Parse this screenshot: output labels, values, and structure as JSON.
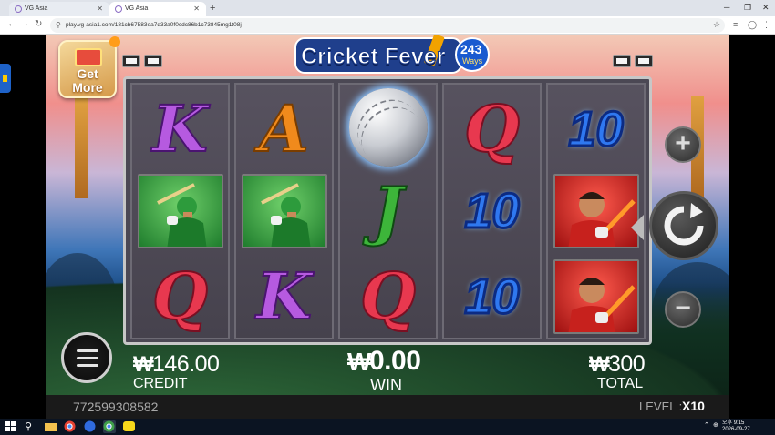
{
  "browser": {
    "tabs": [
      {
        "title": "VG Asia"
      },
      {
        "title": "VG Asia"
      }
    ],
    "url": "play.vg-asia1.com/181cb67583ea7d33a0f0cdc86b1c73845mg1t08j"
  },
  "game": {
    "logo_text": "Cricket Fever",
    "logo_badge": "243",
    "logo_badge_sub": "Ways",
    "get_more": [
      "Get",
      "More"
    ],
    "reels": [
      [
        "K",
        "batsman-green",
        "Q"
      ],
      [
        "A",
        "batsman-green",
        "K"
      ],
      [
        "cricket-ball",
        "J",
        "Q"
      ],
      [
        "Q",
        "10",
        "10"
      ],
      [
        "10",
        "batsman-red",
        "batsman-red"
      ]
    ],
    "credit_value": "146.00",
    "credit_label": "CREDIT",
    "win_value": "0.00",
    "win_label": "WIN",
    "total_value": "300",
    "total_label": "TOTAL",
    "currency": "₩",
    "account_id": "772599308582",
    "level_label": "LEVEL :",
    "level_value": "X10",
    "colors": {
      "letter_K": "#b65ae0",
      "letter_A": "#f08a1c",
      "letter_Q": "#e8384f",
      "letter_J": "#3db53a",
      "ten": "#2f78f0"
    }
  },
  "taskbar": {
    "time": "오후 9:15",
    "date": "2026-09-27"
  }
}
